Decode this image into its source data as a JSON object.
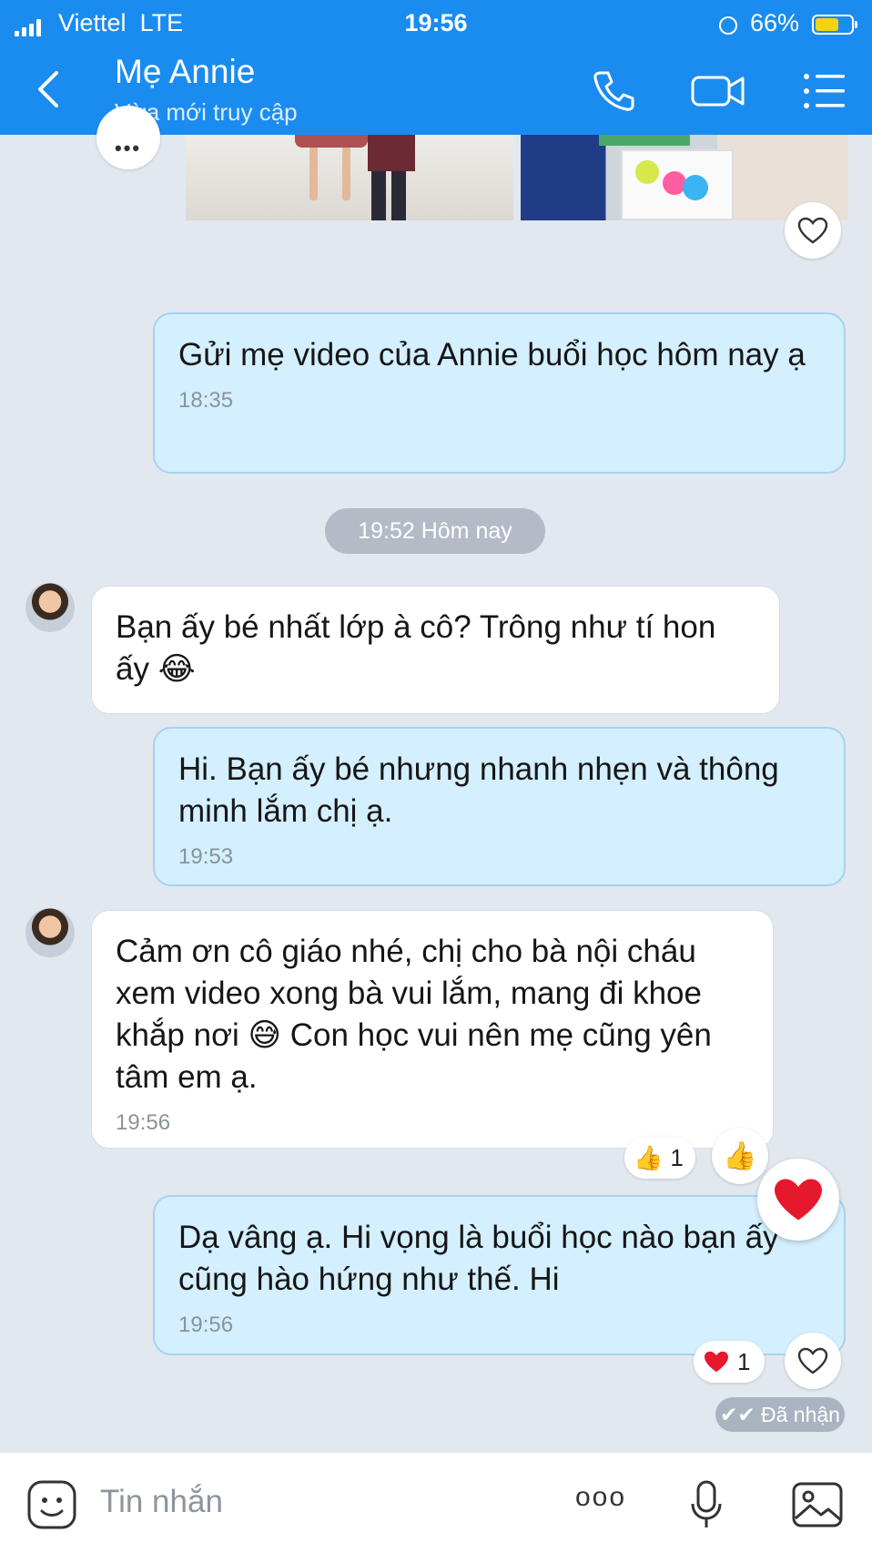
{
  "status_bar": {
    "carrier": "Viettel",
    "network": "LTE",
    "time": "19:56",
    "battery": "66%",
    "battery_level": 0.66
  },
  "header": {
    "title": "Mẹ Annie",
    "subtitle": "Vừa mới truy cập",
    "icons": [
      "back-icon",
      "phone-icon",
      "video-call-icon",
      "menu-list-icon"
    ]
  },
  "messages": [
    {
      "from": "me",
      "text": "Gửi mẹ video của Annie buổi học hôm nay ạ",
      "time": "18:35"
    },
    {
      "from": "contact",
      "text": "Bạn ấy bé nhất lớp à cô? Trông như tí hon ấy 😂"
    },
    {
      "from": "me",
      "text": "Hi. Bạn ấy bé nhưng nhanh nhẹn và thông minh lắm chị ạ.",
      "time": "19:53"
    },
    {
      "from": "contact",
      "text": "Cảm ơn cô giáo nhé, chị cho bà nội cháu xem video xong bà vui lắm, mang đi khoe khắp nơi 😅 Con học vui nên mẹ cũng yên tâm em ạ.",
      "time": "19:56"
    },
    {
      "from": "me",
      "text": "Dạ vâng ạ. Hi vọng là buổi học nào bạn ấy cũng hào hứng như thế. Hi",
      "time": "19:56"
    }
  ],
  "date_separator": "19:52 Hôm nay",
  "reactions": {
    "msg4": {
      "emoji": "👍",
      "count": "1"
    },
    "msg5": {
      "emoji": "❤️",
      "count": "1"
    }
  },
  "received_status": "Đã nhận",
  "input": {
    "placeholder": "Tin nhắn",
    "more": "ooo"
  },
  "colors": {
    "header": "#1a8cf0",
    "outgoing_bubble": "#d4efff",
    "background": "#e2e8f0",
    "heart": "#e5192b"
  }
}
